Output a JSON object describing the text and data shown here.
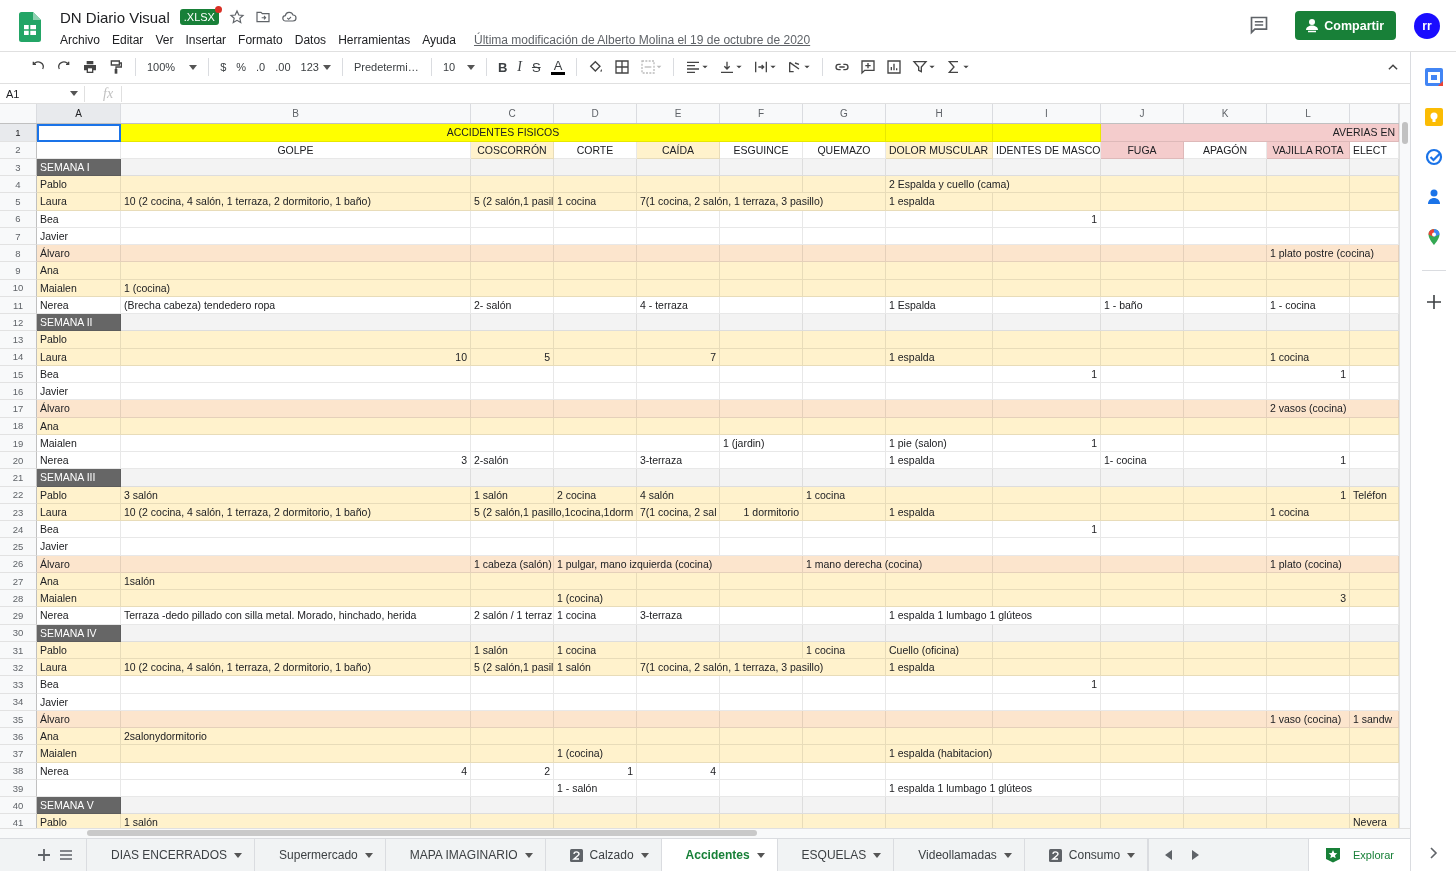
{
  "header": {
    "title": "DN Diario Visual",
    "file_badge": ".XLSX",
    "menu": [
      "Archivo",
      "Editar",
      "Ver",
      "Insertar",
      "Formato",
      "Datos",
      "Herramientas",
      "Ayuda"
    ],
    "last_edit": "Última modificación de Alberto Molina el 19 de octubre de 2020",
    "share": "Compartir",
    "avatar": "rr"
  },
  "toolbar": {
    "zoom": "100%",
    "currency": "$",
    "percent": "%",
    "decrease_decimals": ".0",
    "increase_decimals": ".00",
    "number_format": "123",
    "font": "Predetermi…",
    "font_size": "10",
    "bold": "B",
    "italic": "I",
    "strikethrough": "S",
    "text_color": "A"
  },
  "formula_bar": {
    "name_box": "A1",
    "label": "fx"
  },
  "sheet": {
    "columns": [
      "A",
      "B",
      "C",
      "D",
      "E",
      "F",
      "G",
      "H",
      "I",
      "J",
      "K",
      "L"
    ],
    "rows": [
      {
        "number": "1",
        "kind": "section",
        "cells": {
          "A": {
            "color": "#ffffff",
            "selected": true
          },
          "B-G": {
            "text": "ACCIDENTES FISICOS",
            "color": "#ffff00",
            "centered": true
          },
          "H": {
            "color": "#ffff00"
          },
          "I": {
            "color": "#ffff00"
          },
          "J-M": {
            "text": "AVERIAS EN",
            "color": "#f4cccc",
            "right": true
          }
        }
      },
      {
        "number": "2",
        "kind": "header",
        "cells": {
          "B": {
            "text": "GOLPE",
            "centered": true
          },
          "C": {
            "text": "COSCORRÓN",
            "color": "#fff2cc",
            "centered": true
          },
          "D": {
            "text": "CORTE",
            "centered": true
          },
          "E": {
            "text": "CAÍDA",
            "color": "#fff2cc",
            "centered": true
          },
          "F": {
            "text": "ESGUINCE",
            "centered": true
          },
          "G": {
            "text": "QUEMAZO",
            "centered": true
          },
          "H": {
            "text": "DOLOR MUSCULAR",
            "color": "#fff2cc"
          },
          "I": {
            "text": "IDENTES DE MASCO",
            "right": true
          },
          "J": {
            "text": "FUGA",
            "color": "#f4cccc",
            "centered": true
          },
          "K": {
            "text": "APAGÓN",
            "centered": true
          },
          "L": {
            "text": "VAJILLA ROTA",
            "color": "#f4cccc",
            "centered": true
          },
          "M": {
            "text": "ELECT"
          }
        }
      },
      {
        "number": "3",
        "kind": "week",
        "cells": {
          "A": "SEMANA I"
        }
      },
      {
        "number": "4",
        "kind": "data",
        "color": "#fff2cc",
        "cells": {
          "A": "Pablo",
          "H": "2 Espalda y cuello (cama)"
        }
      },
      {
        "number": "5",
        "kind": "data",
        "color": "#fff2cc",
        "cells": {
          "A": "Laura",
          "B": "10 (2 cocina, 4 salón, 1 terraza, 2 dormitorio, 1 baño)",
          "C": "5 (2 salón,1 pasil",
          "D": "1 cocina",
          "E": "7(1 cocina, 2 salón, 1 terraza, 3 pasillo)",
          "H": "1 espalda"
        }
      },
      {
        "number": "6",
        "kind": "data",
        "color": "#ffffff",
        "cells": {
          "A": "Bea",
          "I": {
            "text": "1",
            "right": true
          }
        }
      },
      {
        "number": "7",
        "kind": "data",
        "color": "#ffffff",
        "cells": {
          "A": "Javier"
        }
      },
      {
        "number": "8",
        "kind": "data",
        "color": "#fce5cd",
        "cells": {
          "A": "Álvaro",
          "L": "1 plato postre (cocina)"
        }
      },
      {
        "number": "9",
        "kind": "data",
        "color": "#fff2cc",
        "cells": {
          "A": "Ana"
        }
      },
      {
        "number": "10",
        "kind": "data",
        "color": "#fff2cc",
        "cells": {
          "A": "Maialen",
          "B": "1 (cocina)"
        }
      },
      {
        "number": "11",
        "kind": "data",
        "color": "#ffffff",
        "cells": {
          "A": "Nerea",
          "B": "(Brecha cabeza) tendedero ropa",
          "C": "2- salón",
          "E": "4 - terraza",
          "H": "1 Espalda",
          "J": "1 - baño",
          "L": "1 - cocina"
        }
      },
      {
        "number": "12",
        "kind": "week",
        "cells": {
          "A": "SEMANA II"
        }
      },
      {
        "number": "13",
        "kind": "data",
        "color": "#fff2cc",
        "cells": {
          "A": "Pablo"
        }
      },
      {
        "number": "14",
        "kind": "data",
        "color": "#fff2cc",
        "cells": {
          "A": "Laura",
          "B": {
            "text": "10",
            "right": true
          },
          "C": {
            "text": "5",
            "right": true
          },
          "E": {
            "text": "7",
            "right": true
          },
          "H": "1 espalda",
          "L": "1 cocina"
        }
      },
      {
        "number": "15",
        "kind": "data",
        "color": "#ffffff",
        "cells": {
          "A": "Bea",
          "I": {
            "text": "1",
            "right": true
          },
          "L": {
            "text": "1",
            "right": true
          }
        }
      },
      {
        "number": "16",
        "kind": "data",
        "color": "#ffffff",
        "cells": {
          "A": "Javier"
        }
      },
      {
        "number": "17",
        "kind": "data",
        "color": "#fce5cd",
        "cells": {
          "A": "Álvaro",
          "L": "2 vasos (cocina)"
        }
      },
      {
        "number": "18",
        "kind": "data",
        "color": "#fff2cc",
        "cells": {
          "A": "Ana"
        }
      },
      {
        "number": "19",
        "kind": "data",
        "color": "#ffffff",
        "cells": {
          "A": "Maialen",
          "F": "1 (jardin)",
          "H": "1 pie (salon)",
          "I": {
            "text": "1",
            "right": true
          }
        }
      },
      {
        "number": "20",
        "kind": "data",
        "color": "#ffffff",
        "cells": {
          "A": "Nerea",
          "B": {
            "text": "3",
            "right": true
          },
          "C": "2-salón",
          "E": "3-terraza",
          "H": "1 espalda",
          "J": "1- cocina",
          "L": {
            "text": "1",
            "right": true
          }
        }
      },
      {
        "number": "21",
        "kind": "week",
        "cells": {
          "A": "SEMANA III"
        }
      },
      {
        "number": "22",
        "kind": "data",
        "color": "#fff2cc",
        "cells": {
          "A": "Pablo",
          "B": "3 salón",
          "C": "1 salón",
          "D": "2 cocina",
          "E": "4 salón",
          "G": "1 cocina",
          "L": {
            "text": "1",
            "right": true
          },
          "M": "Teléfon"
        }
      },
      {
        "number": "23",
        "kind": "data",
        "color": "#fff2cc",
        "cells": {
          "A": "Laura",
          "B": "10 (2 cocina, 4 salón, 1 terraza, 2 dormitorio, 1 baño)",
          "C": "5 (2 salón,1 pasillo,1cocina,1dorm",
          "E": "7(1 cocina, 2 sal",
          "F": {
            "text": "1 dormitorio",
            "right": true
          },
          "H": "1 espalda",
          "L": "1 cocina"
        }
      },
      {
        "number": "24",
        "kind": "data",
        "color": "#ffffff",
        "cells": {
          "A": "Bea",
          "I": {
            "text": "1",
            "right": true
          }
        }
      },
      {
        "number": "25",
        "kind": "data",
        "color": "#ffffff",
        "cells": {
          "A": "Javier"
        }
      },
      {
        "number": "26",
        "kind": "data",
        "color": "#fce5cd",
        "cells": {
          "A": "Álvaro",
          "C": "1 cabeza (salón)",
          "D": "1 pulgar, mano izquierda (cocina)",
          "G": "1 mano derecha (cocina)",
          "L": "1 plato (cocina)"
        }
      },
      {
        "number": "27",
        "kind": "data",
        "color": "#fff2cc",
        "cells": {
          "A": "Ana",
          "B": "1salón"
        }
      },
      {
        "number": "28",
        "kind": "data",
        "color": "#fff2cc",
        "cells": {
          "A": "Maialen",
          "D": "1 (cocina)",
          "L": {
            "text": "3",
            "right": true
          }
        }
      },
      {
        "number": "29",
        "kind": "data",
        "color": "#ffffff",
        "cells": {
          "A": "Nerea",
          "B": "Terraza -dedo pillado con silla metal. Morado, hinchado, herida",
          "C": "2 salón / 1 terraz",
          "D": "1 cocina",
          "E": "3-terraza",
          "H": "1 espalda 1 lumbago 1 glúteos"
        }
      },
      {
        "number": "30",
        "kind": "week",
        "cells": {
          "A": "SEMANA IV"
        }
      },
      {
        "number": "31",
        "kind": "data",
        "color": "#fff2cc",
        "cells": {
          "A": "Pablo",
          "C": "1 salón",
          "D": "1 cocina",
          "G": "1 cocina",
          "H": "Cuello (oficina)"
        }
      },
      {
        "number": "32",
        "kind": "data",
        "color": "#fff2cc",
        "cells": {
          "A": "Laura",
          "B": "10 (2 cocina, 4 salón, 1 terraza, 2 dormitorio, 1 baño)",
          "C": "5 (2 salón,1 pasil",
          "D": "1 salón",
          "E": "7(1 cocina, 2 salón, 1 terraza, 3 pasillo)",
          "H": "1 espalda"
        }
      },
      {
        "number": "33",
        "kind": "data",
        "color": "#ffffff",
        "cells": {
          "A": "Bea",
          "I": {
            "text": "1",
            "right": true
          }
        }
      },
      {
        "number": "34",
        "kind": "data",
        "color": "#ffffff",
        "cells": {
          "A": "Javier"
        }
      },
      {
        "number": "35",
        "kind": "data",
        "color": "#fce5cd",
        "cells": {
          "A": "Álvaro",
          "L": "1 vaso (cocina)",
          "M": "1 sandw"
        }
      },
      {
        "number": "36",
        "kind": "data",
        "color": "#fff2cc",
        "cells": {
          "A": "Ana",
          "B": "2salonydormitorio"
        }
      },
      {
        "number": "37",
        "kind": "data",
        "color": "#fff2cc",
        "cells": {
          "A": "Maialen",
          "D": "1 (cocina)",
          "H": "1 espalda (habitacion)"
        }
      },
      {
        "number": "38",
        "kind": "data",
        "color": "#ffffff",
        "cells": {
          "A": "Nerea",
          "B": {
            "text": "4",
            "right": true
          },
          "C": {
            "text": "2",
            "right": true
          },
          "D": {
            "text": "1",
            "right": true
          },
          "E": {
            "text": "4",
            "right": true
          }
        }
      },
      {
        "number": "39",
        "kind": "data",
        "color": "#ffffff",
        "cells": {
          "D": "1 - salón",
          "H": "1 espalda 1 lumbago 1 glúteos"
        }
      },
      {
        "number": "40",
        "kind": "week",
        "cells": {
          "A": "SEMANA V"
        }
      },
      {
        "number": "41",
        "kind": "data",
        "color": "#fff2cc",
        "cells": {
          "A": "Pablo",
          "B": "1 salón",
          "M": "Nevera"
        }
      }
    ]
  },
  "sheet_tabs": [
    {
      "label": "DIAS ENCERRADOS",
      "selected": false,
      "badge": false
    },
    {
      "label": "Supermercado",
      "selected": false,
      "badge": false
    },
    {
      "label": "MAPA IMAGINARIO",
      "selected": false,
      "badge": false
    },
    {
      "label": "Calzado",
      "selected": false,
      "badge": true
    },
    {
      "label": "Accidentes",
      "selected": true,
      "badge": false
    },
    {
      "label": "ESQUELAS",
      "selected": false,
      "badge": false
    },
    {
      "label": "Videollamadas",
      "selected": false,
      "badge": false
    },
    {
      "label": "Consumo",
      "selected": false,
      "badge": true
    }
  ],
  "explore": "Explorar"
}
